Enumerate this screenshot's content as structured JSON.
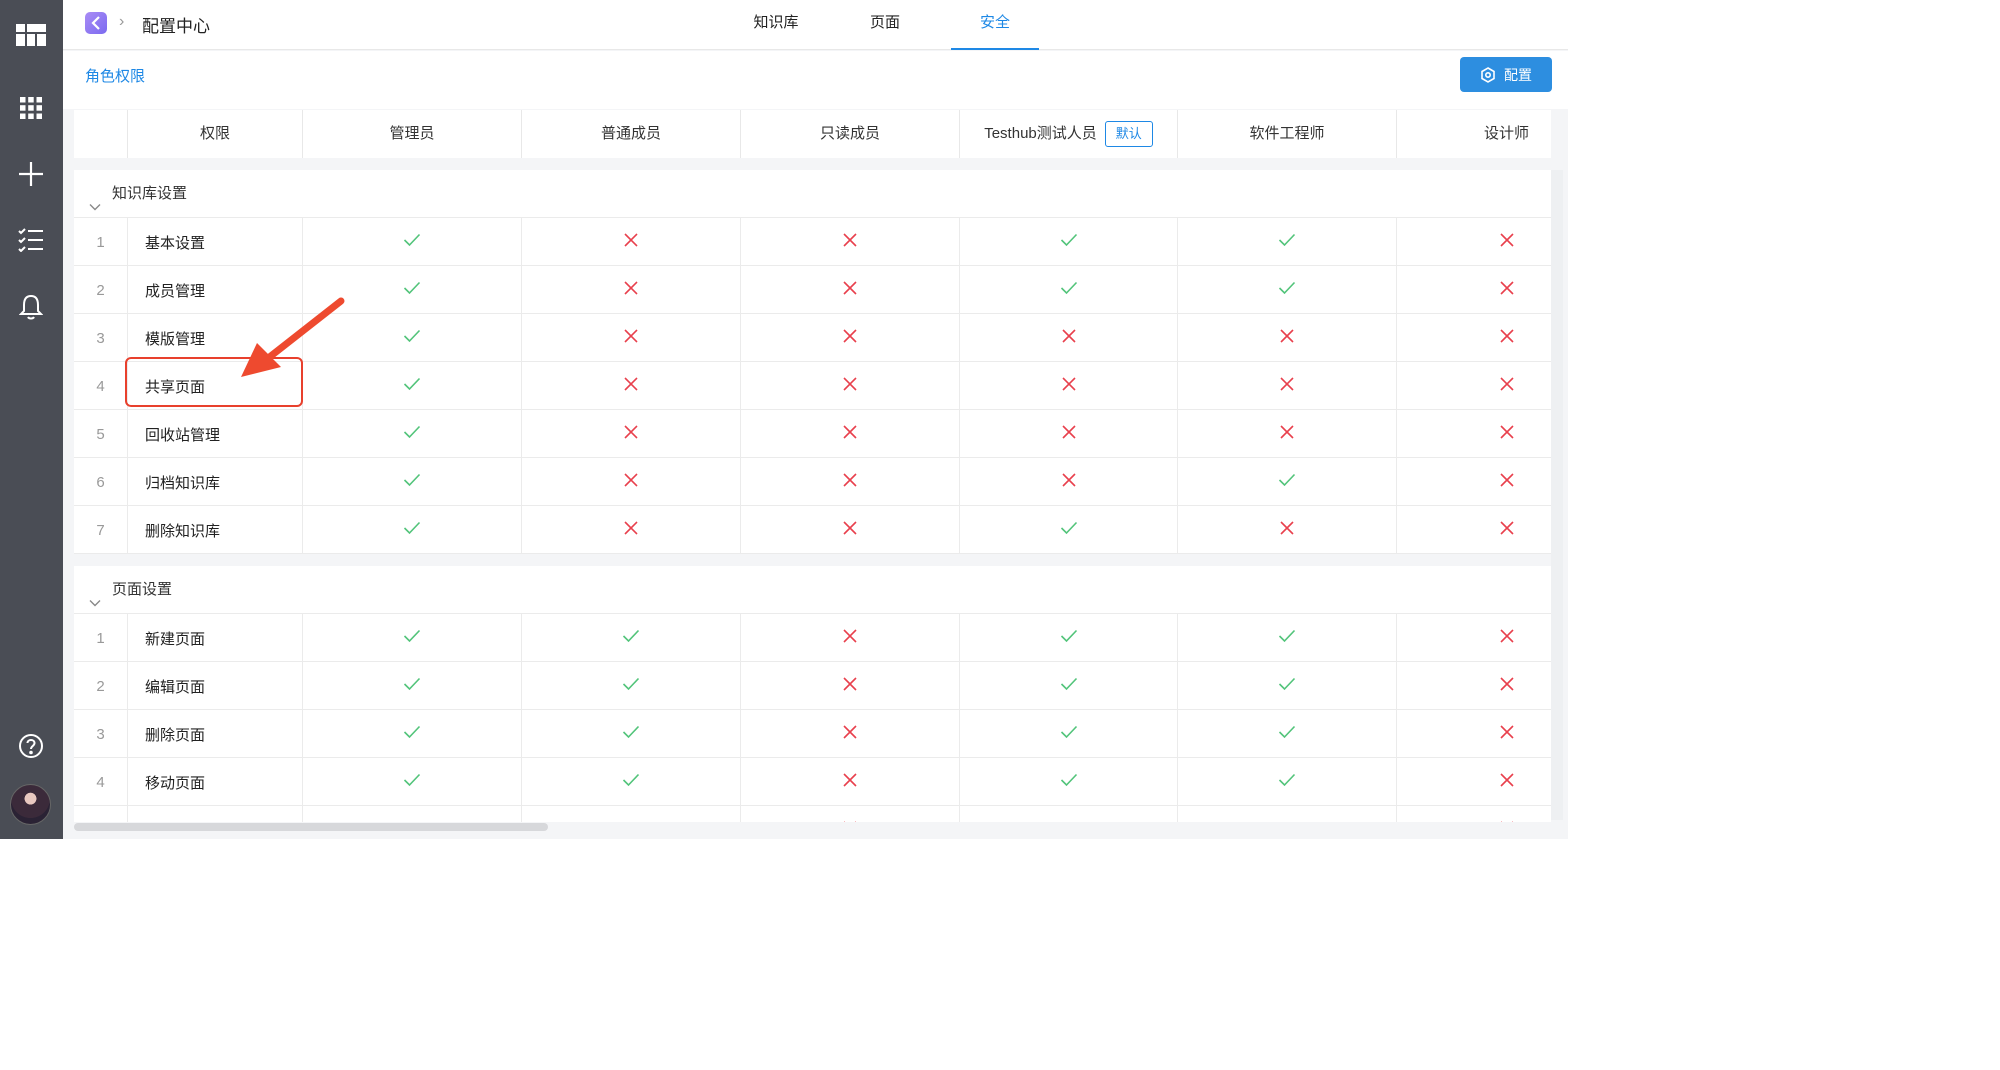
{
  "breadcrumb": {
    "title": "配置中心"
  },
  "tabs": [
    {
      "label": "知识库",
      "active": false
    },
    {
      "label": "页面",
      "active": false
    },
    {
      "label": "安全",
      "active": true
    }
  ],
  "subbar": {
    "role_link": "角色权限",
    "config_button": "配置"
  },
  "colors": {
    "accent": "#1e88e5",
    "check": "#52c47a",
    "cross": "#e8404d",
    "sidebar": "#4a4d55"
  },
  "icons": {
    "sidebar": [
      "dashboard-icon",
      "apps-grid-icon",
      "plus-icon",
      "task-list-icon",
      "bell-icon",
      "help-icon"
    ],
    "check": "check-icon",
    "cross": "cross-icon"
  },
  "table": {
    "headers": {
      "permission": "权限",
      "roles": [
        "管理员",
        "普通成员",
        "只读成员",
        "Testhub测试人员",
        "软件工程师",
        "设计师"
      ],
      "default_badge": "默认"
    },
    "sections": [
      {
        "title": "知识库设置",
        "rows": [
          {
            "index": "1",
            "name": "基本设置",
            "perms": [
              true,
              false,
              false,
              true,
              true,
              false
            ]
          },
          {
            "index": "2",
            "name": "成员管理",
            "perms": [
              true,
              false,
              false,
              true,
              true,
              false
            ]
          },
          {
            "index": "3",
            "name": "模版管理",
            "perms": [
              true,
              false,
              false,
              false,
              false,
              false
            ]
          },
          {
            "index": "4",
            "name": "共享页面",
            "perms": [
              true,
              false,
              false,
              false,
              false,
              false
            ]
          },
          {
            "index": "5",
            "name": "回收站管理",
            "perms": [
              true,
              false,
              false,
              false,
              false,
              false
            ]
          },
          {
            "index": "6",
            "name": "归档知识库",
            "perms": [
              true,
              false,
              false,
              false,
              true,
              false
            ]
          },
          {
            "index": "7",
            "name": "删除知识库",
            "perms": [
              true,
              false,
              false,
              true,
              false,
              false
            ]
          }
        ]
      },
      {
        "title": "页面设置",
        "rows": [
          {
            "index": "1",
            "name": "新建页面",
            "perms": [
              true,
              true,
              false,
              true,
              true,
              false
            ]
          },
          {
            "index": "2",
            "name": "编辑页面",
            "perms": [
              true,
              true,
              false,
              true,
              true,
              false
            ]
          },
          {
            "index": "3",
            "name": "删除页面",
            "perms": [
              true,
              true,
              false,
              true,
              true,
              false
            ]
          },
          {
            "index": "4",
            "name": "移动页面",
            "perms": [
              true,
              true,
              false,
              true,
              true,
              false
            ]
          },
          {
            "index": "",
            "name": "",
            "perms": [
              true,
              true,
              false,
              true,
              true,
              false
            ]
          }
        ]
      }
    ]
  }
}
